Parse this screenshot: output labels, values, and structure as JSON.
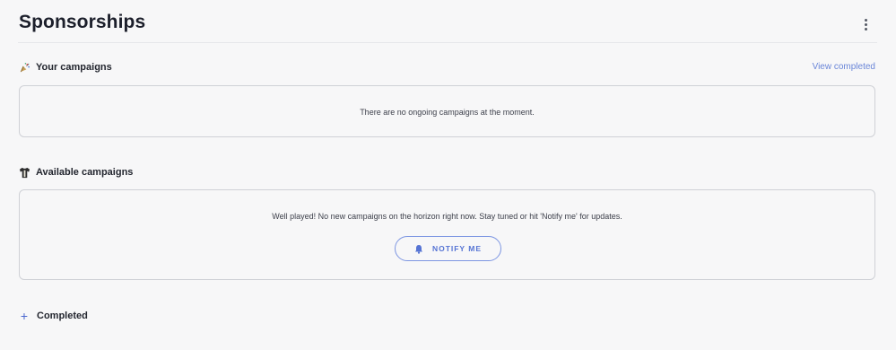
{
  "header": {
    "title": "Sponsorships",
    "menu_icon": "more-vertical-icon"
  },
  "your_campaigns": {
    "icon": "confetti-popper-icon",
    "title": "Your campaigns",
    "link_label": "View completed",
    "empty_message": "There are no ongoing campaigns at the moment."
  },
  "available_campaigns": {
    "icon": "jersey-icon",
    "title": "Available campaigns",
    "empty_message": "Well played! No new campaigns on the horizon right now. Stay tuned or hit 'Notify me' for updates.",
    "button_label": "NOTIFY ME",
    "button_icon": "bell-icon"
  },
  "completed": {
    "icon": "plus-icon",
    "label": "Completed"
  },
  "colors": {
    "accent": "#5674d4",
    "border": "#cfd1d6",
    "background": "#f7f7f8"
  }
}
